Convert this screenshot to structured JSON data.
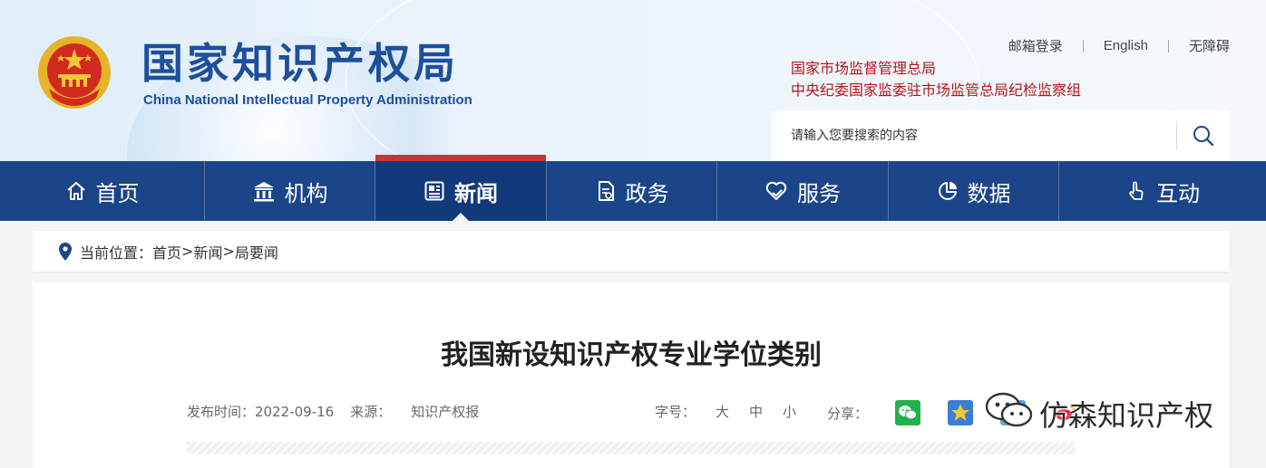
{
  "header": {
    "logo_cn": "国家知识产权局",
    "logo_en": "China National Intellectual Property Administration",
    "top_links": [
      "邮箱登录",
      "English",
      "无障碍"
    ],
    "supervise_line1": "国家市场监督管理总局",
    "supervise_line2": "中央纪委国家监委驻市场监管总局纪检监察组",
    "search_placeholder": "请输入您要搜索的内容"
  },
  "nav": {
    "items": [
      {
        "label": "首页",
        "icon": "home-icon"
      },
      {
        "label": "机构",
        "icon": "building-icon"
      },
      {
        "label": "新闻",
        "icon": "newspaper-icon",
        "active": true
      },
      {
        "label": "政务",
        "icon": "document-icon"
      },
      {
        "label": "服务",
        "icon": "heart-hand-icon"
      },
      {
        "label": "数据",
        "icon": "pie-chart-icon"
      },
      {
        "label": "互动",
        "icon": "hand-pointer-icon"
      }
    ]
  },
  "breadcrumb": {
    "prefix": "当前位置：",
    "crumbs": [
      "首页",
      "新闻",
      "局要闻"
    ],
    "sep": ">"
  },
  "article": {
    "title": "我国新设知识产权专业学位类别",
    "publish_label": "发布时间：",
    "publish_date": "2022-09-16",
    "source_label": "来源：",
    "source": "知识产权报",
    "fontsize_label": "字号：",
    "sizes": [
      "大",
      "中",
      "小"
    ],
    "share_label": "分享："
  },
  "watermark": "仿森知识产权",
  "colors": {
    "nav_bg": "#1b4588",
    "nav_active_bg": "#123a7a",
    "nav_active_top": "#c9333a",
    "logo_blue": "#1d4f9c",
    "supervise_red": "#b4161b"
  }
}
